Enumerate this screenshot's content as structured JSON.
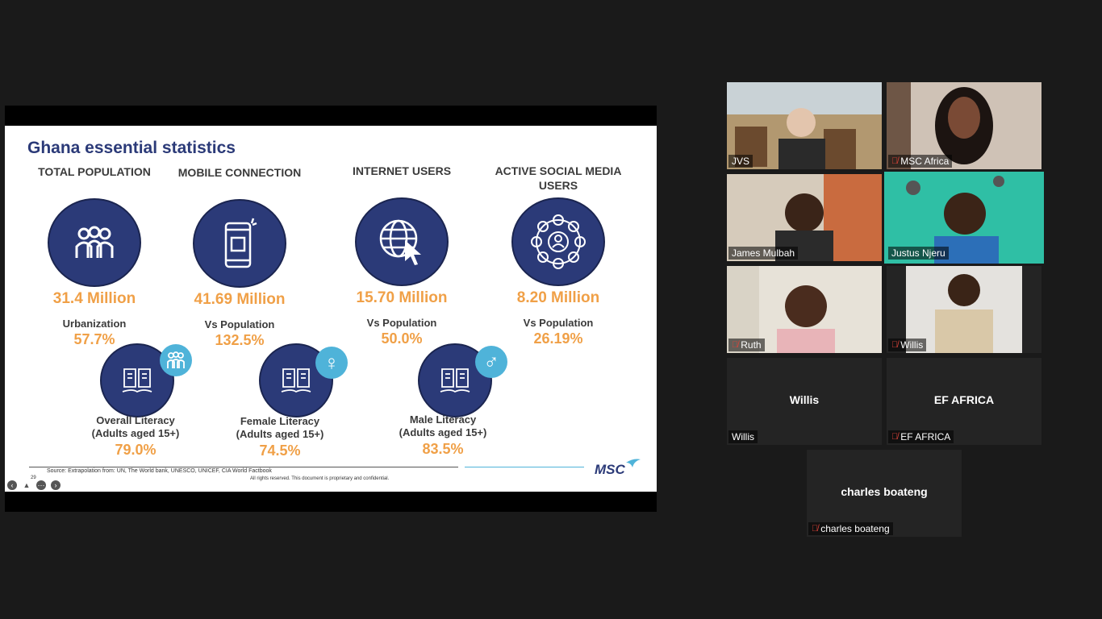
{
  "slide": {
    "title": "Ghana essential statistics",
    "stats": [
      {
        "label": "TOTAL POPULATION",
        "value": "31.4 Million",
        "sub": "Urbanization",
        "pct": "57.7%",
        "icon": "people-icon"
      },
      {
        "label": "MOBILE CONNECTION",
        "value": "41.69 Million",
        "sub": "Vs Population",
        "pct": "132.5%",
        "icon": "mobile-phone-icon"
      },
      {
        "label": "INTERNET USERS",
        "value": "15.70 Million",
        "sub": "Vs Population",
        "pct": "50.0%",
        "icon": "globe-cursor-icon"
      },
      {
        "label": "ACTIVE SOCIAL MEDIA USERS",
        "value": "8.20 Million",
        "sub": "Vs Population",
        "pct": "26.19%",
        "icon": "social-network-icon"
      }
    ],
    "literacy": [
      {
        "label": "Overall Literacy",
        "age": "(Adults aged 15+)",
        "pct": "79.0%",
        "badge": "group-icon"
      },
      {
        "label": "Female Literacy",
        "age": "(Adults aged 15+)",
        "pct": "74.5%",
        "badge": "female-symbol-icon"
      },
      {
        "label": "Male Literacy",
        "age": "(Adults aged 15+)",
        "pct": "83.5%",
        "badge": "male-symbol-icon"
      }
    ],
    "source": "Source: Extrapolation from: UN, The World bank, UNESCO, UNICEF, CIA World Factbook",
    "rights": "All rights reserved. This document is proprietary and confidential.",
    "logo": "MSC",
    "page_number": "29"
  },
  "participants": [
    {
      "name": "JVS",
      "muted": false,
      "video": true
    },
    {
      "name": "MSC Africa",
      "muted": true,
      "video": true
    },
    {
      "name": "James Mulbah",
      "muted": false,
      "video": true
    },
    {
      "name": "Justus Njeru",
      "muted": false,
      "video": true,
      "active_speaker": true
    },
    {
      "name": "Ruth",
      "muted": true,
      "video": true
    },
    {
      "name": "Willis",
      "muted": true,
      "video": true
    },
    {
      "name": "Willis",
      "muted": false,
      "video": false
    },
    {
      "name": "EF AFRICA",
      "muted": true,
      "video": false
    },
    {
      "name": "charles boateng",
      "muted": true,
      "video": false
    }
  ],
  "colors": {
    "navy": "#2b3a78",
    "orange": "#f0a047",
    "badge_blue": "#4fb3d9",
    "active_border": "#e7e35a"
  }
}
